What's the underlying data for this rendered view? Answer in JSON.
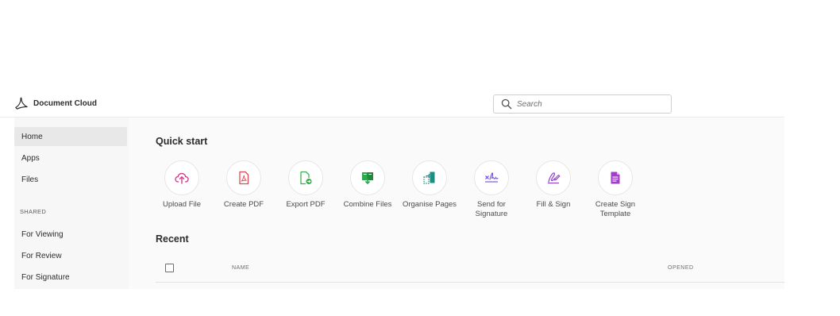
{
  "header": {
    "brand": "Document Cloud",
    "search_placeholder": "Search"
  },
  "sidebar": {
    "items": [
      {
        "label": "Home",
        "active": true
      },
      {
        "label": "Apps"
      },
      {
        "label": "Files"
      }
    ],
    "shared_heading": "SHARED",
    "shared_items": [
      {
        "label": "For Viewing"
      },
      {
        "label": "For Review"
      },
      {
        "label": "For Signature"
      }
    ]
  },
  "main": {
    "quick_start_title": "Quick start",
    "tools": [
      {
        "label": "Upload File",
        "icon": "upload-cloud-icon",
        "color": "#d43d8f"
      },
      {
        "label": "Create PDF",
        "icon": "create-pdf-icon",
        "color": "#e34850"
      },
      {
        "label": "Export PDF",
        "icon": "export-pdf-icon",
        "color": "#35b34a"
      },
      {
        "label": "Combine Files",
        "icon": "combine-files-icon",
        "color": "#2fa84f"
      },
      {
        "label": "Organise Pages",
        "icon": "organise-pages-icon",
        "color": "#1b8f82"
      },
      {
        "label": "Send for Signature",
        "icon": "send-signature-icon",
        "color": "#6c4fd1"
      },
      {
        "label": "Fill & Sign",
        "icon": "fill-sign-icon",
        "color": "#8e3fc8"
      },
      {
        "label": "Create Sign Template",
        "icon": "sign-template-icon",
        "color": "#a23fc8"
      }
    ],
    "recent_title": "Recent",
    "columns": {
      "name": "NAME",
      "opened": "OPENED"
    }
  }
}
